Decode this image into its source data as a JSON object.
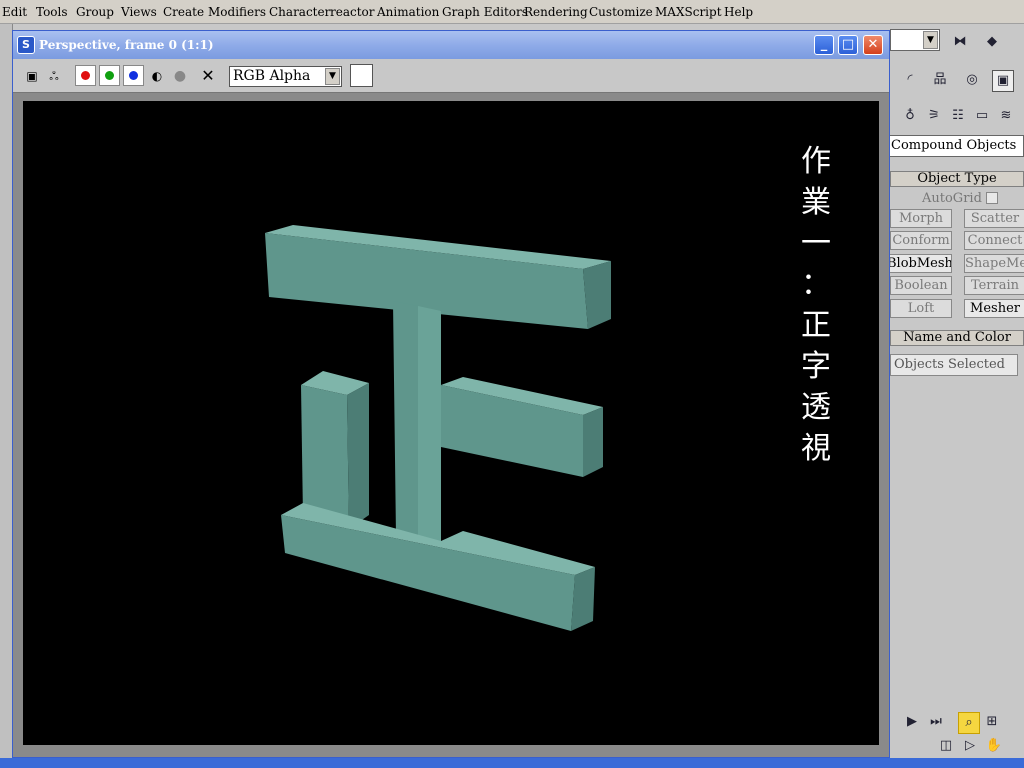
{
  "menu": {
    "items": [
      "Edit",
      "Tools",
      "Group",
      "Views",
      "Create",
      "Modifiers",
      "Character",
      "reactor",
      "Animation",
      "Graph Editors",
      "Rendering",
      "Customize",
      "MAXScript",
      "Help"
    ]
  },
  "window": {
    "title": "Perspective, frame 0 (1:1)",
    "minimize_glyph": "_",
    "maximize_glyph": "□",
    "close_glyph": "✕"
  },
  "toolbar": {
    "save_glyph": "▣",
    "clone_glyph": "ஃ",
    "channel_colors": [
      "#e01010",
      "#10a010",
      "#1030e0"
    ],
    "mono_glyph": "◐",
    "clear_glyph": "✕",
    "channel_select": "RGB Alpha"
  },
  "render": {
    "text_lines": [
      "作",
      "業",
      "一",
      "：",
      "正",
      "字",
      "透",
      "視"
    ],
    "object_color": "#6aa398"
  },
  "panel": {
    "category_select": "Compound Objects",
    "object_type_title": "Object Type",
    "autogrid_label": "AutoGrid",
    "buttons": [
      "Morph",
      "Scatter",
      "Conform",
      "Connect",
      "BlobMesh",
      "ShapeMerge",
      "Boolean",
      "Terrain",
      "Loft",
      "Mesher"
    ],
    "name_color_title": "Name and Color",
    "name_field": "Objects Selected"
  }
}
